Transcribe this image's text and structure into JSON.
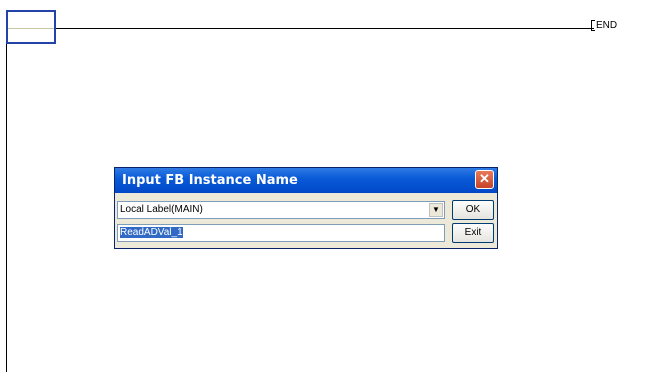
{
  "ladder": {
    "end_label": "END"
  },
  "dialog": {
    "title": "Input FB Instance Name",
    "close_glyph": "✕",
    "scope_select": {
      "value": "Local Label(MAIN)",
      "arrow_glyph": "▼"
    },
    "instance_name": {
      "value": "ReadADVal_1"
    },
    "ok_label": "OK",
    "exit_label": "Exit"
  }
}
